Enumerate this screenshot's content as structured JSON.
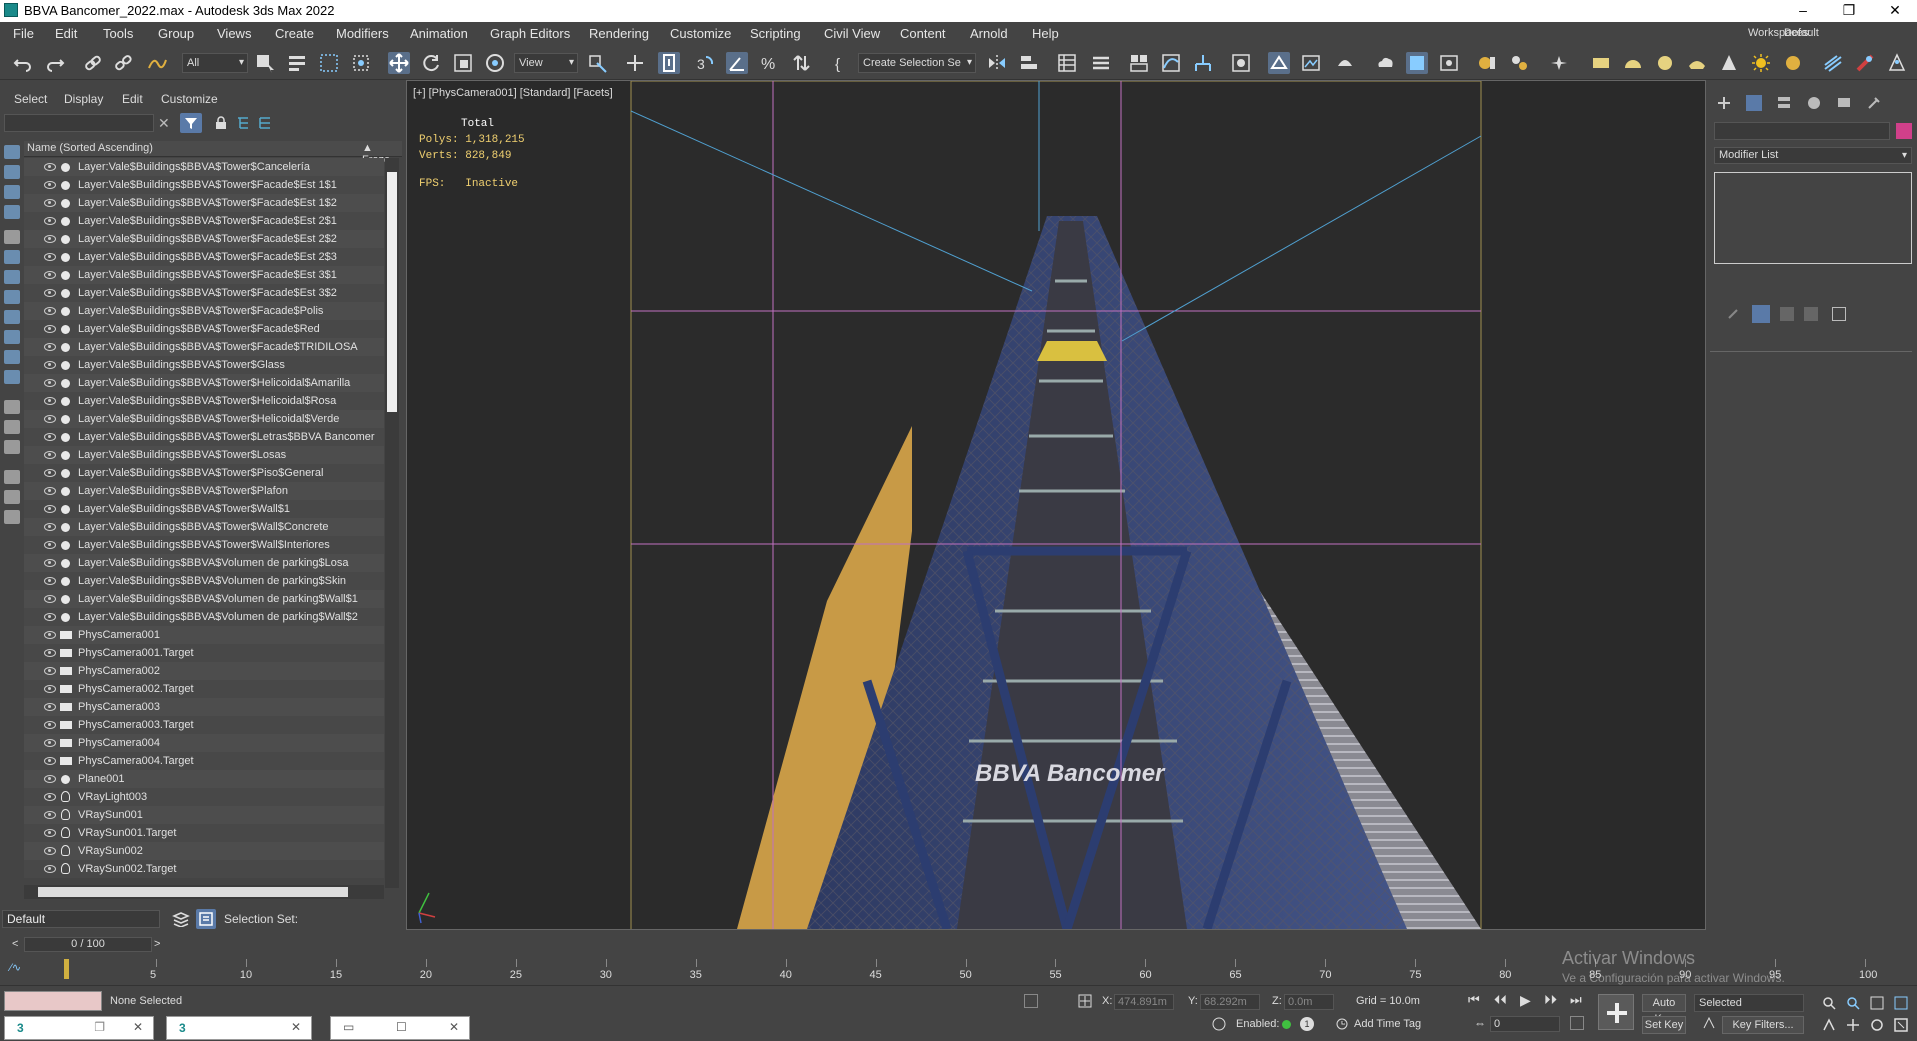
{
  "window": {
    "title": "BBVA Bancomer_2022.max - Autodesk 3ds Max 2022"
  },
  "menu": {
    "items": [
      "File",
      "Edit",
      "Tools",
      "Group",
      "Views",
      "Create",
      "Modifiers",
      "Animation",
      "Graph Editors",
      "Rendering",
      "Customize",
      "Scripting",
      "Civil View",
      "Content",
      "Arnold",
      "Help"
    ],
    "workspaces_label": "Workspaces:",
    "workspaces_value": "Default"
  },
  "toolbar": {
    "filter_value": "All",
    "refcoord_value": "View",
    "selection_set_value": "Create Selection Se"
  },
  "scene_explorer": {
    "tabs": [
      "Select",
      "Display",
      "Edit",
      "Customize"
    ],
    "search_placeholder": "",
    "column_name": "Name (Sorted Ascending)",
    "column_frozen": "▲ Froze",
    "rows": [
      {
        "label": "Layer:Vale$Buildings$BBVA$Tower$Cancelería",
        "icon": "dot"
      },
      {
        "label": "Layer:Vale$Buildings$BBVA$Tower$Facade$Est 1$1",
        "icon": "dot"
      },
      {
        "label": "Layer:Vale$Buildings$BBVA$Tower$Facade$Est 1$2",
        "icon": "dot"
      },
      {
        "label": "Layer:Vale$Buildings$BBVA$Tower$Facade$Est 2$1",
        "icon": "dot"
      },
      {
        "label": "Layer:Vale$Buildings$BBVA$Tower$Facade$Est 2$2",
        "icon": "dot"
      },
      {
        "label": "Layer:Vale$Buildings$BBVA$Tower$Facade$Est 2$3",
        "icon": "dot"
      },
      {
        "label": "Layer:Vale$Buildings$BBVA$Tower$Facade$Est 3$1",
        "icon": "dot"
      },
      {
        "label": "Layer:Vale$Buildings$BBVA$Tower$Facade$Est 3$2",
        "icon": "dot"
      },
      {
        "label": "Layer:Vale$Buildings$BBVA$Tower$Facade$Polis",
        "icon": "dot"
      },
      {
        "label": "Layer:Vale$Buildings$BBVA$Tower$Facade$Red",
        "icon": "dot"
      },
      {
        "label": "Layer:Vale$Buildings$BBVA$Tower$Facade$TRIDILOSA",
        "icon": "dot"
      },
      {
        "label": "Layer:Vale$Buildings$BBVA$Tower$Glass",
        "icon": "dot"
      },
      {
        "label": "Layer:Vale$Buildings$BBVA$Tower$Helicoidal$Amarilla",
        "icon": "dot"
      },
      {
        "label": "Layer:Vale$Buildings$BBVA$Tower$Helicoidal$Rosa",
        "icon": "dot"
      },
      {
        "label": "Layer:Vale$Buildings$BBVA$Tower$Helicoidal$Verde",
        "icon": "dot"
      },
      {
        "label": "Layer:Vale$Buildings$BBVA$Tower$Letras$BBVA Bancomer",
        "icon": "dot"
      },
      {
        "label": "Layer:Vale$Buildings$BBVA$Tower$Losas",
        "icon": "dot"
      },
      {
        "label": "Layer:Vale$Buildings$BBVA$Tower$Piso$General",
        "icon": "dot"
      },
      {
        "label": "Layer:Vale$Buildings$BBVA$Tower$Plafon",
        "icon": "dot"
      },
      {
        "label": "Layer:Vale$Buildings$BBVA$Tower$Wall$1",
        "icon": "dot"
      },
      {
        "label": "Layer:Vale$Buildings$BBVA$Tower$Wall$Concrete",
        "icon": "dot"
      },
      {
        "label": "Layer:Vale$Buildings$BBVA$Tower$Wall$Interiores",
        "icon": "dot"
      },
      {
        "label": "Layer:Vale$Buildings$BBVA$Volumen de parking$Losa",
        "icon": "dot"
      },
      {
        "label": "Layer:Vale$Buildings$BBVA$Volumen de parking$Skin",
        "icon": "dot"
      },
      {
        "label": "Layer:Vale$Buildings$BBVA$Volumen de parking$Wall$1",
        "icon": "dot"
      },
      {
        "label": "Layer:Vale$Buildings$BBVA$Volumen de parking$Wall$2",
        "icon": "dot"
      },
      {
        "label": "PhysCamera001",
        "icon": "cam"
      },
      {
        "label": "PhysCamera001.Target",
        "icon": "cam"
      },
      {
        "label": "PhysCamera002",
        "icon": "cam"
      },
      {
        "label": "PhysCamera002.Target",
        "icon": "cam"
      },
      {
        "label": "PhysCamera003",
        "icon": "cam"
      },
      {
        "label": "PhysCamera003.Target",
        "icon": "cam"
      },
      {
        "label": "PhysCamera004",
        "icon": "cam"
      },
      {
        "label": "PhysCamera004.Target",
        "icon": "cam"
      },
      {
        "label": "Plane001",
        "icon": "dot"
      },
      {
        "label": "VRayLight003",
        "icon": "bulb"
      },
      {
        "label": "VRaySun001",
        "icon": "bulb"
      },
      {
        "label": "VRaySun001.Target",
        "icon": "bulb"
      },
      {
        "label": "VRaySun002",
        "icon": "bulb"
      },
      {
        "label": "VRaySun002.Target",
        "icon": "bulb"
      }
    ],
    "layer_value": "Default",
    "selection_set_label": "Selection Set:"
  },
  "viewport": {
    "label": "[+] [PhysCamera001] [Standard] [Facets]",
    "stats_total": "Total",
    "polys_label": "Polys:",
    "polys_value": "1,318,215",
    "verts_label": "Verts:",
    "verts_value": "828,849",
    "fps_label": "FPS:",
    "fps_value": "Inactive",
    "building_logo": "BBVA Bancomer"
  },
  "command_panel": {
    "modifier_list": "Modifier List"
  },
  "timeline": {
    "frame_counter": "0 / 100",
    "ticks": [
      "5",
      "10",
      "15",
      "20",
      "25",
      "30",
      "35",
      "40",
      "45",
      "50",
      "55",
      "60",
      "65",
      "70",
      "75",
      "80",
      "85",
      "90",
      "95",
      "100"
    ]
  },
  "status": {
    "selection": "None Selected",
    "x_label": "X:",
    "x_value": "474.891m",
    "y_label": "Y:",
    "y_value": "68.292m",
    "z_label": "Z:",
    "z_value": "0.0m",
    "grid": "Grid = 10.0m",
    "enabled_label": "Enabled:",
    "add_time_tag": "Add Time Tag",
    "auto_key": "Auto Key",
    "set_key": "Set Key",
    "key_mode_value": "Selected",
    "key_filters": "Key Filters...",
    "frame_value": "0",
    "activate_windows": "Activar Windows",
    "activate_windows_sub": "Ve a Configuración para activar Windows."
  },
  "colors": {
    "accent_blue": "#5a6f8a",
    "stats_yellow": "#f0d070",
    "guide_magenta": "#c070c0",
    "guide_cyan": "#50a0d0",
    "swatch_pink": "#d0408a"
  }
}
